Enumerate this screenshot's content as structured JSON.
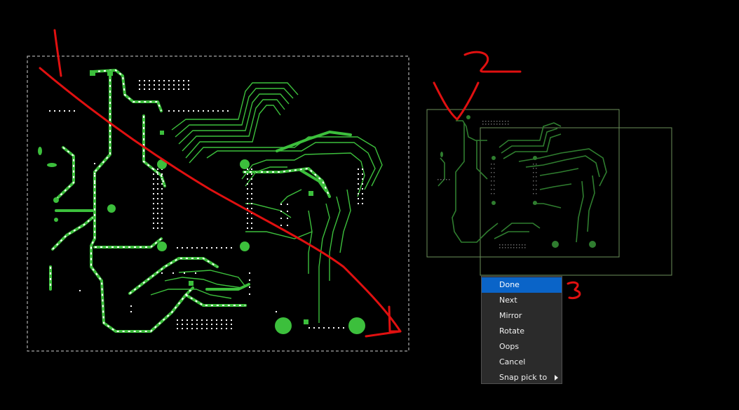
{
  "context_menu": {
    "items": [
      {
        "label": "Done",
        "active": true,
        "submenu": false
      },
      {
        "label": "Next",
        "active": false,
        "submenu": false
      },
      {
        "label": "Mirror",
        "active": false,
        "submenu": false
      },
      {
        "label": "Rotate",
        "active": false,
        "submenu": false
      },
      {
        "label": "Oops",
        "active": false,
        "submenu": false
      },
      {
        "label": "Cancel",
        "active": false,
        "submenu": false
      },
      {
        "label": "Snap pick to",
        "active": false,
        "submenu": true
      }
    ]
  },
  "annotations": {
    "marks": [
      "1",
      "2",
      "3"
    ],
    "color": "#e01010"
  },
  "colors": {
    "background": "#000000",
    "trace": "#3cbf3c",
    "trace_dim": "#2f7d2f",
    "pad": "#ffffff",
    "outline": "#6b8f5a",
    "menu_bg": "#2b2b2b",
    "menu_highlight": "#0a64c8"
  }
}
